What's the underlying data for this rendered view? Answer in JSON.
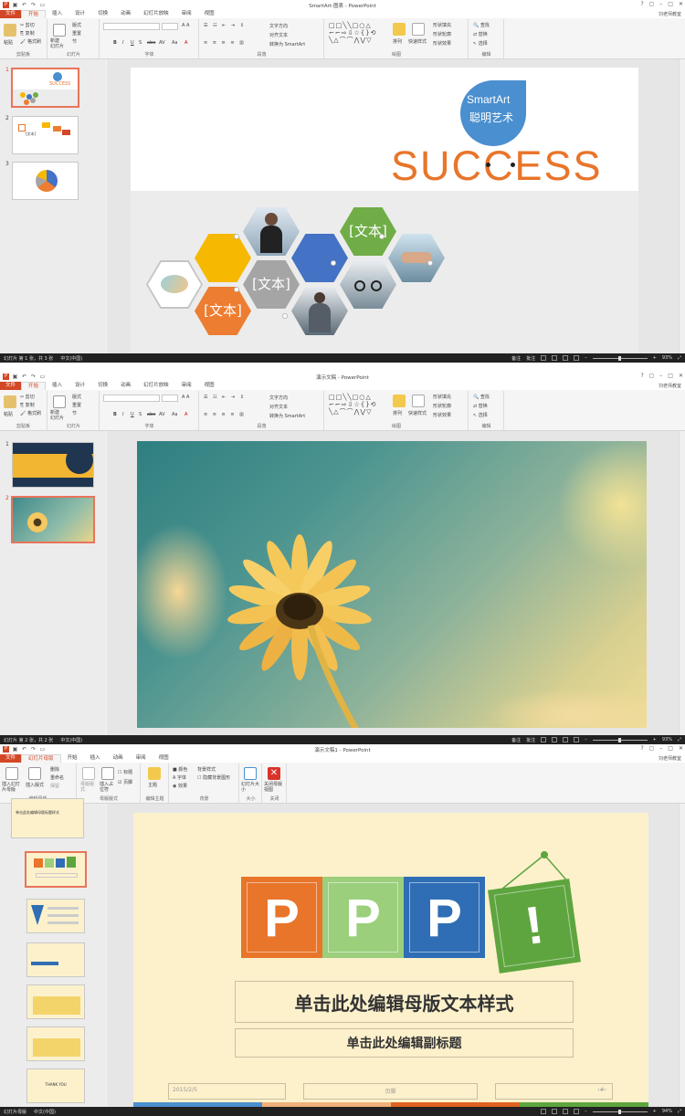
{
  "window1": {
    "title": "SmartArt-图表 - PowerPoint",
    "user": "刘老师教室",
    "tabs": [
      "文件",
      "开始",
      "插入",
      "设计",
      "切换",
      "动画",
      "幻灯片放映",
      "审阅",
      "视图"
    ],
    "active_tab": "开始",
    "ribbon": {
      "clipboard": {
        "paste": "粘贴",
        "cut": "剪切",
        "copy": "复制",
        "format_painter": "格式刷",
        "label": "剪贴板"
      },
      "slides": {
        "new_slide": "新建\n幻灯片",
        "layout": "版式",
        "reset": "重置",
        "section": "节",
        "label": "幻灯片"
      },
      "font": {
        "label": "字体",
        "bold": "B",
        "italic": "I",
        "underline": "U",
        "shadow": "S",
        "strike": "abe",
        "spacing": "AV",
        "case": "Aa"
      },
      "paragraph": {
        "label": "段落",
        "text_direction": "文字方向",
        "align_text": "对齐文本",
        "convert_smartart": "转换为 SmartArt"
      },
      "drawing": {
        "label": "绘图",
        "arrange": "排列",
        "quick_styles": "快速样式",
        "shape_fill": "形状填充",
        "shape_outline": "形状轮廓",
        "shape_effects": "形状效果"
      },
      "editing": {
        "label": "编辑",
        "find": "查找",
        "replace": "替换",
        "select": "选择"
      }
    },
    "slides": [
      {
        "num": "1"
      },
      {
        "num": "2"
      },
      {
        "num": "3"
      }
    ],
    "selected_slide": "1",
    "slide": {
      "smartart_en": "SmartArt",
      "smartart_cn": "聪明艺术",
      "success_text": "SUCCESS",
      "hex_text_1": "[文本]",
      "hex_text_2": "[文本]",
      "hex_text_3": "[文本]",
      "thumb1_text": "SUCCESS",
      "thumb2_text": "[文本]"
    },
    "status": {
      "slide_info": "幻灯片 第 1 张，共 3 张",
      "lang": "中文(中国)",
      "notes": "备注",
      "comments": "批注",
      "zoom": "93%"
    }
  },
  "window2": {
    "title": "演示文稿 - PowerPoint",
    "user": "刘老师教室",
    "tabs": [
      "文件",
      "开始",
      "插入",
      "设计",
      "切换",
      "动画",
      "幻灯片放映",
      "审阅",
      "视图"
    ],
    "active_tab": "开始",
    "slides": [
      {
        "num": "1"
      },
      {
        "num": "2"
      }
    ],
    "selected_slide": "2",
    "status": {
      "slide_info": "幻灯片 第 2 张，共 2 张",
      "lang": "中文(中国)",
      "notes": "备注",
      "comments": "批注",
      "zoom": "93%"
    }
  },
  "window3": {
    "title": "演示文稿1 - PowerPoint",
    "user": "刘老师教室",
    "tabs": [
      "文件",
      "幻灯片母版",
      "开始",
      "插入",
      "动画",
      "审阅",
      "视图"
    ],
    "active_tab": "幻灯片母版",
    "ribbon": {
      "insert_master": "插入幻灯片母版",
      "insert_layout": "插入版式",
      "delete": "删除",
      "rename": "重命名",
      "preserve": "保留",
      "master_layout": "母版版式",
      "insert_placeholder": "插入占位符",
      "title_cb": "标题",
      "footer_cb": "页脚",
      "theme": "主题",
      "colors": "颜色",
      "fonts": "字体",
      "effects": "效果",
      "bg_styles": "背景样式",
      "hide_bg": "隐藏背景图形",
      "slide_size": "幻灯片大小",
      "close_master": "关闭母版视图",
      "grp_edit_master": "编辑母版",
      "grp_master_layout": "母版版式",
      "grp_edit_theme": "编辑主题",
      "grp_background": "背景",
      "grp_size": "大小",
      "grp_close": "关闭"
    },
    "slide": {
      "letters": [
        "P",
        "P",
        "P",
        "!"
      ],
      "title_placeholder": "单击此处编辑母版文本样式",
      "subtitle_placeholder": "单击此处编辑副标题",
      "date": "2015/2/5",
      "footer": "页脚",
      "page_num": "‹#›",
      "thumb_top_text": "单击此处编辑母版标题样式",
      "thumb_last_text": "THANK YOU"
    },
    "status": {
      "view": "幻灯片母版",
      "lang": "中文(中国)",
      "zoom": "94%"
    }
  },
  "colors": {
    "ppt_orange": "#d24726",
    "hex_yellow": "#f6b800",
    "hex_blue": "#4472c4",
    "hex_green": "#70ad47",
    "hex_orange": "#ed7d31",
    "hex_gray": "#a5a5a5",
    "master_bg": "#fdf1cc",
    "p_orange": "#e8752a",
    "p_green": "#9bcf7c",
    "p_blue": "#2f6eb5",
    "bang_green": "#5ea53f"
  }
}
